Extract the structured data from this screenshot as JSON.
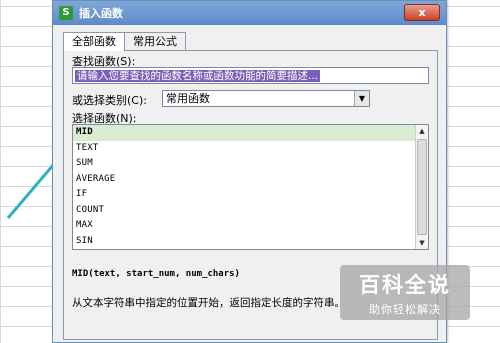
{
  "dialog": {
    "title": "插入函数",
    "close_label": "x",
    "app_icon_letter": "S"
  },
  "tabs": [
    {
      "label": "全部函数",
      "active": true
    },
    {
      "label": "常用公式",
      "active": false
    }
  ],
  "search": {
    "label": "查找函数(S):",
    "value": "请输入您要查找的函数名称或函数功能的简要描述..."
  },
  "category": {
    "label": "或选择类别(C):",
    "value": "常用函数"
  },
  "function_list": {
    "label": "选择函数(N):",
    "items": [
      "MID",
      "TEXT",
      "SUM",
      "AVERAGE",
      "IF",
      "COUNT",
      "MAX",
      "SIN"
    ],
    "selected_index": 0
  },
  "syntax": "MID(text, start_num, num_chars)",
  "description": "从文本字符串中指定的位置开始，返回指定长度的字符串。",
  "watermark": {
    "title": "百科全说",
    "subtitle": "助你轻松解决"
  },
  "colors": {
    "accent_arrow": "#2bb3c0",
    "selection": "#7d5fb8",
    "list_highlight": "#d9ecd2"
  }
}
